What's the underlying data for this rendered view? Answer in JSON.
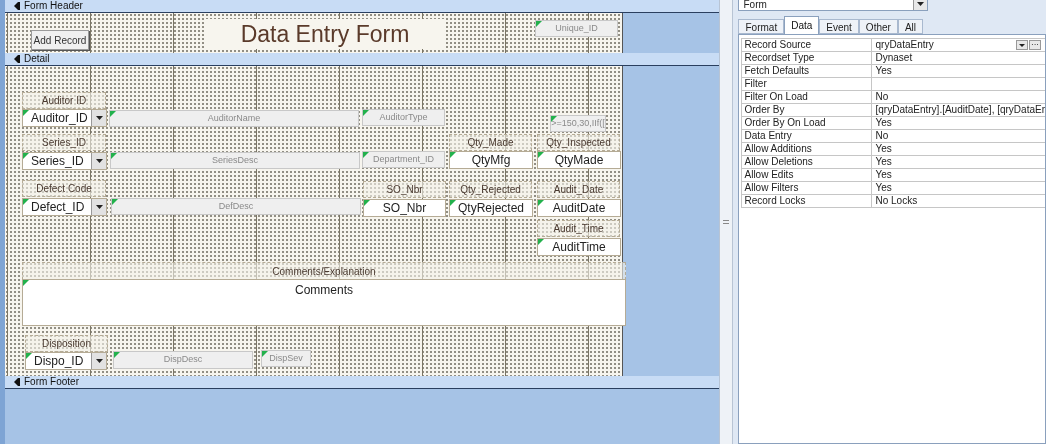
{
  "sections": [
    {
      "kind": "header",
      "title": "Form Header",
      "controls": [
        {
          "kind": "button",
          "text": "Add Record"
        },
        {
          "kind": "title",
          "text": "Data Entry Form"
        },
        {
          "kind": "calc",
          "text": "Unique_ID"
        }
      ]
    },
    {
      "kind": "detail",
      "title": "Detail",
      "controls": [
        {
          "kind": "label",
          "text": "Auditor ID"
        },
        {
          "kind": "combo",
          "text": "Auditor_ID"
        },
        {
          "kind": "calc",
          "text": "AuditorName"
        },
        {
          "kind": "calc",
          "text": "AuditorType"
        },
        {
          "kind": "calc",
          "text": ">=150,30,IIf(["
        },
        {
          "kind": "label",
          "text": "Series_ID"
        },
        {
          "kind": "combo",
          "text": "Series_ID"
        },
        {
          "kind": "calc",
          "text": "SeriesDesc"
        },
        {
          "kind": "calc",
          "text": "Department_ID"
        },
        {
          "kind": "label",
          "text": "Qty_Made"
        },
        {
          "kind": "textbox",
          "text": "QtyMfg"
        },
        {
          "kind": "label",
          "text": "Qty_Inspected"
        },
        {
          "kind": "textbox",
          "text": "QtyMade"
        },
        {
          "kind": "label",
          "text": "Defect Code"
        },
        {
          "kind": "combo",
          "text": "Defect_ID"
        },
        {
          "kind": "calc",
          "text": "DefDesc"
        },
        {
          "kind": "label",
          "text": "SO_Nbr"
        },
        {
          "kind": "textbox",
          "text": "SO_Nbr"
        },
        {
          "kind": "label",
          "text": "Qty_Rejected"
        },
        {
          "kind": "textbox",
          "text": "QtyRejected"
        },
        {
          "kind": "label",
          "text": "Audit_Date"
        },
        {
          "kind": "textbox",
          "text": "AuditDate"
        },
        {
          "kind": "label",
          "text": "Audit_Time"
        },
        {
          "kind": "textbox",
          "text": "AuditTime"
        },
        {
          "kind": "label",
          "text": "Comments/Explanation"
        },
        {
          "kind": "memo",
          "text": "Comments"
        },
        {
          "kind": "label",
          "text": "Disposition"
        },
        {
          "kind": "combo",
          "text": "Dispo_ID"
        },
        {
          "kind": "calc",
          "text": "DispDesc"
        },
        {
          "kind": "calc",
          "text": "DispSev"
        }
      ]
    },
    {
      "kind": "footer",
      "title": "Form Footer"
    }
  ],
  "property_sheet": {
    "object_selector": "Form",
    "tabs": [
      {
        "label": "Format",
        "selected": false
      },
      {
        "label": "Data",
        "selected": true
      },
      {
        "label": "Event",
        "selected": false
      },
      {
        "label": "Other",
        "selected": false
      },
      {
        "label": "All",
        "selected": false
      }
    ],
    "properties": [
      {
        "name": "Record Source",
        "value": "qryDataEntry",
        "builder": "···"
      },
      {
        "name": "Recordset Type",
        "value": "Dynaset"
      },
      {
        "name": "Fetch Defaults",
        "value": "Yes"
      },
      {
        "name": "Filter"
      },
      {
        "name": "Filter On Load",
        "value": "No"
      },
      {
        "name": "Order By",
        "value": "[qryDataEntry].[AuditDate], [qryDataEr"
      },
      {
        "name": "Order By On Load",
        "value": "Yes"
      },
      {
        "name": "Data Entry",
        "value": "No"
      },
      {
        "name": "Allow Additions",
        "value": "Yes"
      },
      {
        "name": "Allow Deletions",
        "value": "Yes"
      },
      {
        "name": "Allow Edits",
        "value": "Yes"
      },
      {
        "name": "Allow Filters",
        "value": "Yes"
      },
      {
        "name": "Record Locks",
        "value": "No Locks"
      }
    ]
  }
}
